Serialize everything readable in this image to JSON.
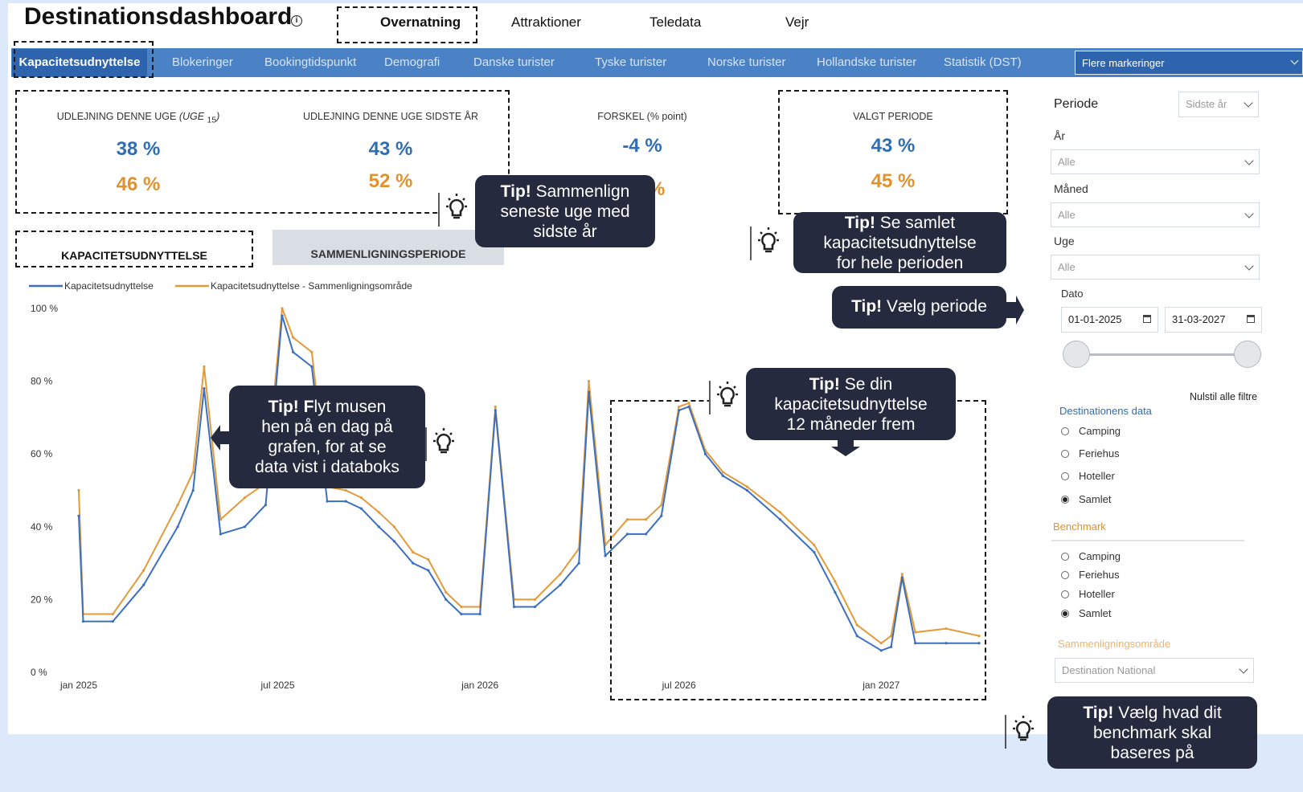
{
  "header": {
    "title": "Destinationsdashboard",
    "info_symbol": "i",
    "tabs": [
      "Overnatning",
      "Attraktioner",
      "Teledata",
      "Vejr"
    ],
    "active_tab": "Overnatning"
  },
  "nav": {
    "active": "Kapacitetsudnyttelse",
    "items": [
      "Blokeringer",
      "Bookingtidspunkt",
      "Demografi",
      "Danske turister",
      "Tyske turister",
      "Norske turister",
      "Hollandske turister",
      "Statistik (DST)"
    ],
    "dropdown": "Flere markeringer"
  },
  "kpis": {
    "week": {
      "title": "UDLEJNING DENNE UGE",
      "title_italic": "(UGE",
      "week_sub": "15",
      "title_end": ")",
      "blue": "38 %",
      "orange": "46 %"
    },
    "last_year": {
      "title": "UDLEJNING DENNE UGE SIDSTE ÅR",
      "blue": "43 %",
      "orange": "52 %"
    },
    "diff": {
      "title": "FORSKEL (% point)",
      "blue": "-4 %",
      "orange_partial": "%"
    },
    "period": {
      "title": "VALGT PERIODE",
      "blue": "43 %",
      "orange": "45 %"
    }
  },
  "chart_tabs": {
    "active": "KAPACITETSUDNYTTELSE",
    "inactive": "SAMMENLIGNINGSPERIODE"
  },
  "tips": {
    "compare": {
      "bold": "Tip!",
      "text1": " Sammenlign",
      "text2": "seneste uge med",
      "text3": "sidste år"
    },
    "total": {
      "bold": "Tip!",
      "text1": " Se samlet",
      "text2": "kapacitetsudnyttelse",
      "text3": "for hele perioden"
    },
    "period": {
      "bold": "Tip!",
      "text1": " Vælg periode"
    },
    "hover": {
      "bold": "Tip! F",
      "text1": "lyt musen",
      "text2": "hen på en dag på",
      "text3": "grafen, for at se",
      "text4": "data vist i databoks"
    },
    "ahead": {
      "bold": "Tip!",
      "text1": " Se din",
      "text2": "kapacitetsudnyttelse",
      "text3": "12 måneder frem"
    },
    "benchmark": {
      "bold": "Tip!",
      "text1": " Vælg hvad dit",
      "text2": "benchmark skal",
      "text3": "baseres på"
    }
  },
  "sidebar": {
    "periode_label": "Periode",
    "periode_value": "Sidste år",
    "aar_label": "År",
    "aar_value": "Alle",
    "maaned_label": "Måned",
    "maaned_value": "Alle",
    "uge_label": "Uge",
    "uge_value": "Alle",
    "dato_label": "Dato",
    "date_from": "01-01-2025",
    "date_to": "31-03-2027",
    "reset": "Nulstil alle filtre",
    "dest_data_label": "Destinationens data",
    "dest_options": [
      "Camping",
      "Feriehus",
      "Hoteller",
      "Samlet"
    ],
    "dest_selected": "Samlet",
    "benchmark_label": "Benchmark",
    "bench_options": [
      "Camping",
      "Feriehus",
      "Hoteller",
      "Samlet"
    ],
    "bench_selected": "Samlet",
    "compare_label": "Sammenligningsområde",
    "compare_value": "Destination National"
  },
  "colors": {
    "blue": "#3b6fbf",
    "orange": "#e39a38",
    "nav": "#4b82c5",
    "tip_bg": "#262a3f",
    "accent_orange": "#e0922f"
  },
  "chart_data": {
    "type": "line",
    "x_ticks": [
      "jan 2025",
      "jul 2025",
      "jan 2026",
      "jul 2026",
      "jan 2027"
    ],
    "y_ticks": [
      "100 %",
      "80 %",
      "60 %",
      "40 %",
      "20 %",
      "0 %"
    ],
    "ylim": [
      0,
      100
    ],
    "legend_placement": "top-left",
    "series": [
      {
        "name": "Kapacitetsudnyttelse",
        "color": "#3b6fbf",
        "x": [
          "2025-01-01",
          "2025-01-05",
          "2025-02-01",
          "2025-03-01",
          "2025-04-01",
          "2025-04-15",
          "2025-04-25",
          "2025-05-10",
          "2025-06-01",
          "2025-06-20",
          "2025-07-05",
          "2025-07-15",
          "2025-08-01",
          "2025-08-15",
          "2025-09-01",
          "2025-09-15",
          "2025-10-01",
          "2025-10-15",
          "2025-11-01",
          "2025-11-15",
          "2025-12-01",
          "2025-12-15",
          "2026-01-01",
          "2026-01-15",
          "2026-02-01",
          "2026-02-20",
          "2026-03-15",
          "2026-04-01",
          "2026-04-10",
          "2026-04-25",
          "2026-05-15",
          "2026-06-01",
          "2026-06-15",
          "2026-07-01",
          "2026-07-10",
          "2026-07-25",
          "2026-08-10",
          "2026-09-01",
          "2026-10-01",
          "2026-11-01",
          "2026-11-20",
          "2026-12-10",
          "2027-01-01",
          "2027-01-10",
          "2027-01-20",
          "2027-02-01",
          "2027-03-01",
          "2027-03-31"
        ],
        "values": [
          43,
          14,
          14,
          24,
          40,
          50,
          78,
          38,
          40,
          46,
          98,
          88,
          84,
          47,
          47,
          45,
          40,
          36,
          30,
          28,
          20,
          16,
          16,
          72,
          18,
          18,
          24,
          30,
          77,
          32,
          38,
          38,
          43,
          72,
          73,
          60,
          54,
          50,
          42,
          33,
          22,
          10,
          6,
          7,
          26,
          8,
          8,
          8
        ]
      },
      {
        "name": "Kapacitetsudnyttelse - Sammenligningsområde",
        "color": "#e39a38",
        "x": [
          "2025-01-01",
          "2025-01-05",
          "2025-02-01",
          "2025-03-01",
          "2025-04-01",
          "2025-04-15",
          "2025-04-25",
          "2025-05-10",
          "2025-06-01",
          "2025-06-20",
          "2025-07-05",
          "2025-07-15",
          "2025-08-01",
          "2025-08-15",
          "2025-09-01",
          "2025-09-15",
          "2025-10-01",
          "2025-10-15",
          "2025-11-01",
          "2025-11-15",
          "2025-12-01",
          "2025-12-15",
          "2026-01-01",
          "2026-01-15",
          "2026-02-01",
          "2026-02-20",
          "2026-03-15",
          "2026-04-01",
          "2026-04-10",
          "2026-04-25",
          "2026-05-15",
          "2026-06-01",
          "2026-06-15",
          "2026-07-01",
          "2026-07-10",
          "2026-07-25",
          "2026-08-10",
          "2026-09-01",
          "2026-10-01",
          "2026-11-01",
          "2026-11-20",
          "2026-12-10",
          "2027-01-01",
          "2027-01-10",
          "2027-01-20",
          "2027-02-01",
          "2027-03-01",
          "2027-03-31"
        ],
        "values": [
          50,
          16,
          16,
          28,
          46,
          55,
          84,
          42,
          48,
          52,
          100,
          92,
          88,
          51,
          50,
          48,
          44,
          40,
          33,
          31,
          22,
          18,
          18,
          73,
          20,
          20,
          27,
          34,
          80,
          35,
          42,
          42,
          46,
          73,
          74,
          61,
          55,
          51,
          44,
          35,
          25,
          13,
          8,
          10,
          27,
          11,
          12,
          10
        ]
      }
    ]
  }
}
